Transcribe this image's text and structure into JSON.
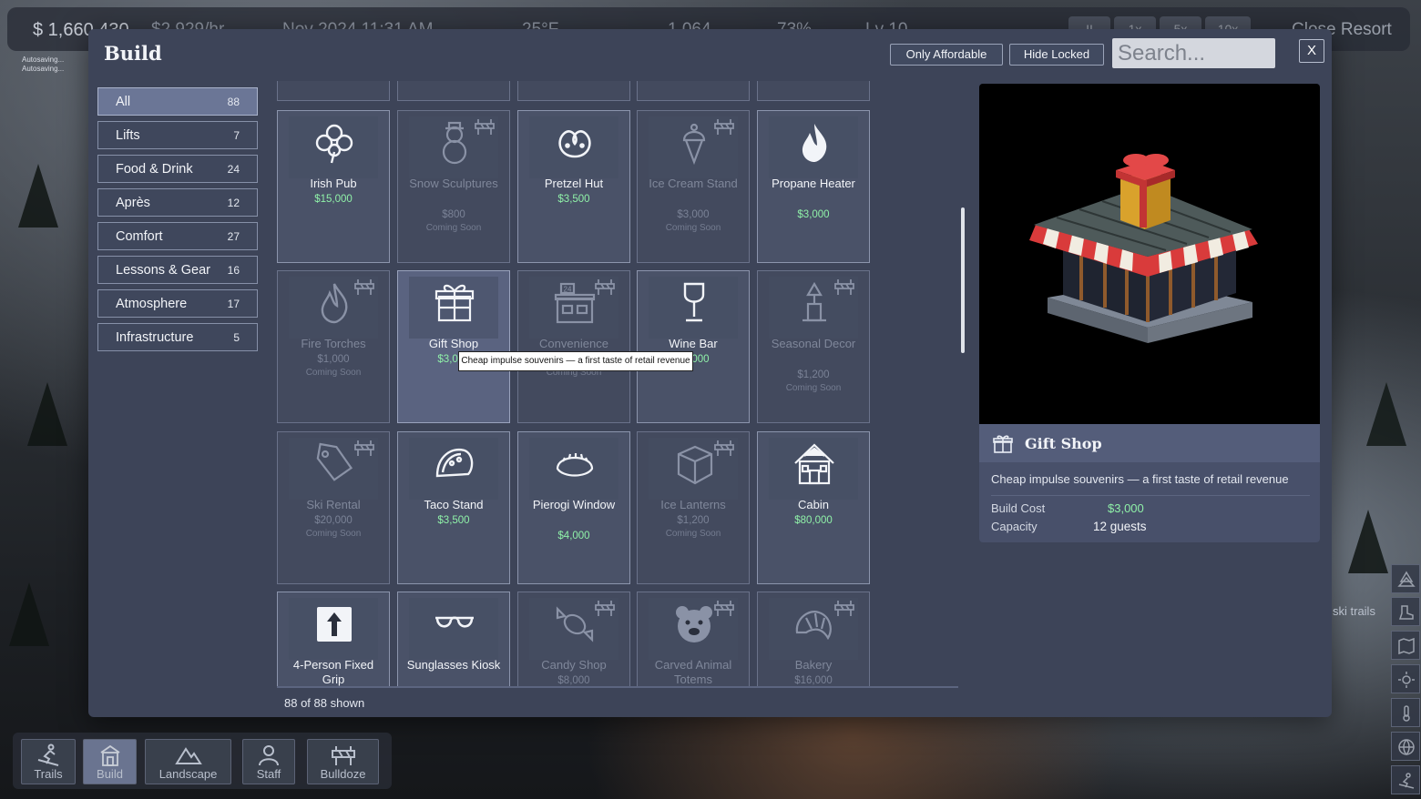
{
  "hud": {
    "money": "$ 1,660,430",
    "income": "$2,929/hr",
    "date": "Nov 2024 11:31 AM",
    "temperature": "25°F",
    "guests": "1,064",
    "satisfaction": "73%",
    "level": "Lv 10",
    "speeds": [
      "II",
      "1x",
      "5x",
      "10x"
    ],
    "close_resort": "Close Resort",
    "autosave_lines": [
      "Autosaving...",
      "Autosaving..."
    ]
  },
  "modal": {
    "title": "Build",
    "only_affordable": "Only Affordable",
    "hide_locked": "Hide Locked",
    "search_placeholder": "Search...",
    "close": "X",
    "shown_count": "88 of 88 shown"
  },
  "categories": [
    {
      "label": "All",
      "count": "88",
      "active": true
    },
    {
      "label": "Lifts",
      "count": "7"
    },
    {
      "label": "Food & Drink",
      "count": "24"
    },
    {
      "label": "Après",
      "count": "12"
    },
    {
      "label": "Comfort",
      "count": "27"
    },
    {
      "label": "Lessons & Gear",
      "count": "16"
    },
    {
      "label": "Atmosphere",
      "count": "17"
    },
    {
      "label": "Infrastructure",
      "count": "5"
    }
  ],
  "items": [
    {
      "name": "Irish Pub",
      "price": "$15,000",
      "locked": false,
      "icon": "clover-icon"
    },
    {
      "name": "Snow Sculptures",
      "price": "$800",
      "status": "Coming Soon",
      "locked": true,
      "icon": "snowman-icon"
    },
    {
      "name": "Pretzel Hut",
      "price": "$3,500",
      "locked": false,
      "icon": "pretzel-icon"
    },
    {
      "name": "Ice Cream Stand",
      "price": "$3,000",
      "status": "Coming Soon",
      "locked": true,
      "icon": "ice-cream-icon"
    },
    {
      "name": "Propane Heater",
      "price": "$3,000",
      "locked": false,
      "icon": "flame-icon"
    },
    {
      "name": "Fire Torches",
      "price": "$1,000",
      "status": "Coming Soon",
      "locked": true,
      "icon": "fire-icon"
    },
    {
      "name": "Gift Shop",
      "price": "$3,000",
      "locked": false,
      "selected": true,
      "icon": "gift-icon"
    },
    {
      "name": "Convenience",
      "price": "$4,000",
      "status": "Coming Soon",
      "locked": true,
      "icon": "store-24-icon"
    },
    {
      "name": "Wine Bar",
      "price": "$6,000",
      "locked": false,
      "icon": "wine-glass-icon"
    },
    {
      "name": "Seasonal Decor",
      "price": "$1,200",
      "status": "Coming Soon",
      "locked": true,
      "icon": "decor-tree-icon"
    },
    {
      "name": "Ski Rental",
      "price": "$20,000",
      "status": "Coming Soon",
      "locked": true,
      "icon": "tag-icon"
    },
    {
      "name": "Taco Stand",
      "price": "$3,500",
      "locked": false,
      "icon": "taco-icon"
    },
    {
      "name": "Pierogi Window",
      "price": "$4,000",
      "locked": false,
      "icon": "dumpling-icon"
    },
    {
      "name": "Ice Lanterns",
      "price": "$1,200",
      "status": "Coming Soon",
      "locked": true,
      "icon": "ice-cube-icon"
    },
    {
      "name": "Cabin",
      "price": "$80,000",
      "locked": false,
      "icon": "cabin-icon"
    },
    {
      "name": "4-Person Fixed Grip",
      "price": "",
      "locked": false,
      "icon": "arrow-up-icon"
    },
    {
      "name": "Sunglasses Kiosk",
      "price": "",
      "locked": false,
      "icon": "sunglasses-icon"
    },
    {
      "name": "Candy Shop",
      "price": "$8,000",
      "locked": true,
      "icon": "candy-icon"
    },
    {
      "name": "Carved Animal Totems",
      "price": "",
      "locked": true,
      "icon": "bear-icon"
    },
    {
      "name": "Bakery",
      "price": "$16,000",
      "locked": true,
      "icon": "croissant-icon"
    }
  ],
  "tooltip": "Cheap impulse souvenirs — a first taste of retail revenue",
  "detail": {
    "title": "Gift Shop",
    "description": "Cheap impulse souvenirs — a first taste of retail revenue",
    "build_cost_label": "Build Cost",
    "build_cost": "$3,000",
    "capacity_label": "Capacity",
    "capacity": "12 guests"
  },
  "toolbar": [
    {
      "label": "Trails",
      "icon": "skier-icon"
    },
    {
      "label": "Build",
      "icon": "build-icon",
      "active": true
    },
    {
      "label": "Landscape",
      "icon": "mountain-icon"
    },
    {
      "label": "Staff",
      "icon": "person-icon"
    },
    {
      "label": "Bulldoze",
      "icon": "barrier-icon"
    }
  ],
  "side_label": "ski trails"
}
